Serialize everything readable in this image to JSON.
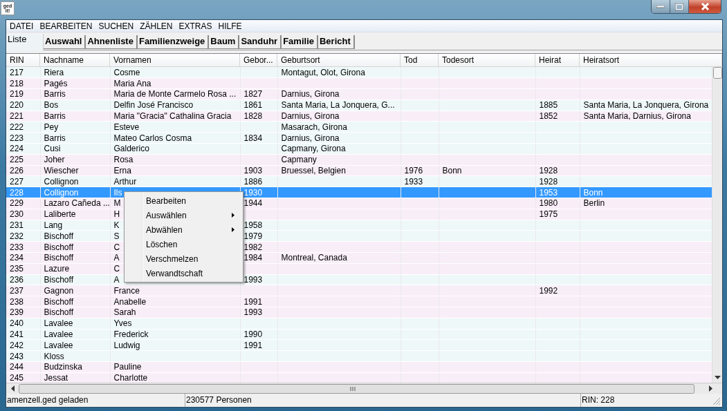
{
  "app_icon": {
    "line_1": "ged",
    "line_2": "it!"
  },
  "menu_bar": [
    "DATEI",
    "BEARBEITEN",
    "SUCHEN",
    "ZÄHLEN",
    "EXTRAS",
    "HILFE"
  ],
  "tabs": [
    {
      "label": "Liste",
      "selected": true
    },
    {
      "label": "Auswahl",
      "selected": false
    },
    {
      "label": "Ahnenliste",
      "selected": false
    },
    {
      "label": "Familienzweige",
      "selected": false
    },
    {
      "label": "Baum",
      "selected": false
    },
    {
      "label": "Sanduhr",
      "selected": false
    },
    {
      "label": "Familie",
      "selected": false
    },
    {
      "label": "Bericht",
      "selected": false
    }
  ],
  "table": {
    "columns": [
      "RIN",
      "Nachname",
      "Vornamen",
      "Gebor...",
      "Geburtsort",
      "Tod",
      "Todesort",
      "Heirat",
      "Heiratsort"
    ],
    "rows": [
      {
        "rin": "217",
        "nachname": "Riera",
        "vornamen": "Cosme",
        "geburtsort": "Montagut, Olot, Girona",
        "color": "#eff8f8",
        "selected": false
      },
      {
        "rin": "218",
        "nachname": "Pagés",
        "vornamen": "Maria Ana",
        "color": "#f8eef8",
        "selected": false
      },
      {
        "rin": "219",
        "nachname": "Barris",
        "vornamen": "Maria de Monte Carmelo Rosa ...",
        "geboren": "1827",
        "geburtsort": "Darnius, Girona",
        "color": "#f8eef8",
        "selected": false
      },
      {
        "rin": "220",
        "nachname": "Bos",
        "vornamen": "Delfin José Francisco",
        "geboren": "1861",
        "geburtsort": "Santa Maria, La Jonquera, G...",
        "heirat": "1885",
        "heiratsort": "Santa Maria, La Jonquera, Girona",
        "color": "#eff8f8",
        "selected": false
      },
      {
        "rin": "221",
        "nachname": "Barris",
        "vornamen": "Maria \"Gracia\" Cathalina Gracia",
        "geboren": "1828",
        "geburtsort": "Darnius, Girona",
        "heirat": "1852",
        "heiratsort": "Santa Maria, Darnius, Girona",
        "color": "#f8eef8",
        "selected": false
      },
      {
        "rin": "222",
        "nachname": "Pey",
        "vornamen": "Esteve",
        "geburtsort": "Masarach, Girona",
        "color": "#eff8f8",
        "selected": false
      },
      {
        "rin": "223",
        "nachname": "Barris",
        "vornamen": "Mateo Carlos Cosma",
        "geboren": "1834",
        "geburtsort": "Darnius, Girona",
        "color": "#eff8f8",
        "selected": false
      },
      {
        "rin": "224",
        "nachname": "Cusi",
        "vornamen": "Galderico",
        "geburtsort": "Capmany, Girona",
        "color": "#eff8f8",
        "selected": false
      },
      {
        "rin": "225",
        "nachname": "Joher",
        "vornamen": "Rosa",
        "geburtsort": "Capmany",
        "color": "#f8eef8",
        "selected": false
      },
      {
        "rin": "226",
        "nachname": "Wiescher",
        "vornamen": "Erna",
        "geboren": "1903",
        "geburtsort": "Bruessel, Belgien",
        "tod": "1976",
        "todesort": "Bonn",
        "heirat": "1928",
        "color": "#f8eef8",
        "selected": false
      },
      {
        "rin": "227",
        "nachname": "Collignon",
        "vornamen": "Arthur",
        "geboren": "1886",
        "tod": "1933",
        "heirat": "1928",
        "color": "#eff8f8",
        "selected": false
      },
      {
        "rin": "228",
        "nachname": "Collignon",
        "vornamen": "Ils",
        "geboren": "1930",
        "heirat": "1953",
        "heiratsort": "Bonn",
        "selected": true
      },
      {
        "rin": "229",
        "nachname": "Lazaro Cañeda ...",
        "vornamen": "M",
        "geboren": "1944",
        "heirat": "1980",
        "heiratsort": "Berlin",
        "color": "#f8eef8",
        "selected": false
      },
      {
        "rin": "230",
        "nachname": "Laliberte",
        "vornamen": "H",
        "heirat": "1975",
        "color": "#f8eef8",
        "selected": false
      },
      {
        "rin": "231",
        "nachname": "Lang",
        "vornamen": "K",
        "geboren": "1958",
        "color": "#eff8f8",
        "selected": false
      },
      {
        "rin": "232",
        "nachname": "Bischoff",
        "vornamen": "S",
        "geboren": "1979",
        "color": "#eff8f8",
        "selected": false
      },
      {
        "rin": "233",
        "nachname": "Bischoff",
        "vornamen": "C",
        "geboren": "1982",
        "color": "#f8eef8",
        "selected": false
      },
      {
        "rin": "234",
        "nachname": "Bischoff",
        "vornamen": "A",
        "geboren": "1984",
        "geburtsort": "Montreal, Canada",
        "color": "#f8eef8",
        "selected": false
      },
      {
        "rin": "235",
        "nachname": "Lazure",
        "vornamen": "C",
        "color": "#f8eef8",
        "selected": false
      },
      {
        "rin": "236",
        "nachname": "Bischoff",
        "vornamen": "A",
        "geboren": "1993",
        "color": "#eff8f8",
        "selected": false
      },
      {
        "rin": "237",
        "nachname": "Gagnon",
        "vornamen": "France",
        "heirat": "1992",
        "color": "#f8eef8",
        "selected": false
      },
      {
        "rin": "238",
        "nachname": "Bischoff",
        "vornamen": "Anabelle",
        "geboren": "1991",
        "color": "#f8eef8",
        "selected": false
      },
      {
        "rin": "239",
        "nachname": "Bischoff",
        "vornamen": "Sarah",
        "geboren": "1993",
        "color": "#f8eef8",
        "selected": false
      },
      {
        "rin": "240",
        "nachname": "Lavalee",
        "vornamen": "Yves",
        "color": "#eff8f8",
        "selected": false
      },
      {
        "rin": "241",
        "nachname": "Lavalee",
        "vornamen": "Frederick",
        "geboren": "1990",
        "color": "#eff8f8",
        "selected": false
      },
      {
        "rin": "242",
        "nachname": "Lavalee",
        "vornamen": "Ludwig",
        "geboren": "1991",
        "color": "#eff8f8",
        "selected": false
      },
      {
        "rin": "243",
        "nachname": "Kloss",
        "color": "#eff8f8",
        "selected": false
      },
      {
        "rin": "244",
        "nachname": "Budzinska",
        "vornamen": "Pauline",
        "color": "#f8eef8",
        "selected": false
      },
      {
        "rin": "245",
        "nachname": "Jessat",
        "vornamen": "Charlotte",
        "color": "#f8eef8",
        "selected": false
      }
    ]
  },
  "context_menu": [
    {
      "label": "Bearbeiten",
      "submenu": false
    },
    {
      "label": "Auswählen",
      "submenu": true
    },
    {
      "label": "Abwählen",
      "submenu": true
    },
    {
      "label": "Löschen",
      "submenu": false
    },
    {
      "label": "Verschmelzen",
      "submenu": false
    },
    {
      "label": "Verwandtschaft",
      "submenu": false
    }
  ],
  "status_bar": [
    "amenzell.ged geladen",
    "230577 Personen",
    "RIN: 228"
  ]
}
